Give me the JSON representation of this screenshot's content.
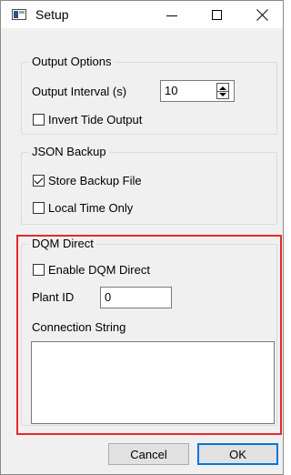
{
  "window": {
    "title": "Setup",
    "icon": "app-icon"
  },
  "output_options": {
    "legend": "Output Options",
    "interval_label": "Output Interval (s)",
    "interval_value": "10",
    "invert_label": "Invert Tide Output",
    "invert_checked": false
  },
  "json_backup": {
    "legend": "JSON Backup",
    "store_label": "Store Backup File",
    "store_checked": true,
    "local_label": "Local Time Only",
    "local_checked": false
  },
  "dqm_direct": {
    "legend": "DQM Direct",
    "enable_label": "Enable DQM Direct",
    "enable_checked": false,
    "plant_label": "Plant ID",
    "plant_value": "0",
    "conn_label": "Connection String",
    "conn_value": ""
  },
  "buttons": {
    "cancel": "Cancel",
    "ok": "OK"
  },
  "highlight_color": "#e8282c"
}
